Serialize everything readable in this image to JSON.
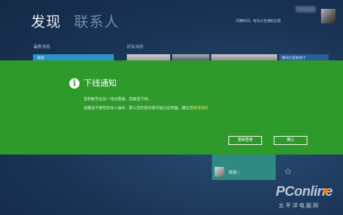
{
  "header": {
    "tabs": [
      "发现",
      "联系人"
    ],
    "notice": "同峰时间，有在公告通知五题"
  },
  "sections": {
    "news_label": "最新消息",
    "friends_label": "好友动态"
  },
  "tiles": {
    "news_tile_text": "微博",
    "side_tile_text": "腾讯已更新到了",
    "bottom_tile_text": "接接~"
  },
  "dialog": {
    "icon": "info-icon",
    "title": "下线通知",
    "line1": "您的帐号在另一地点登录，您被迫下线。",
    "line2_prefix": "如果这不是您的本人操作，那么您的密码很可能已经泄露。建议您",
    "line2_link": "修改密码",
    "buttons": {
      "relogin": "重新登录",
      "confirm": "确认"
    }
  },
  "watermark": {
    "main": "PConline",
    "sub": "太平洋电脑网"
  },
  "colors": {
    "background": "#1b3556",
    "dialog": "#2e9a2b",
    "link": "#f3e94a"
  }
}
